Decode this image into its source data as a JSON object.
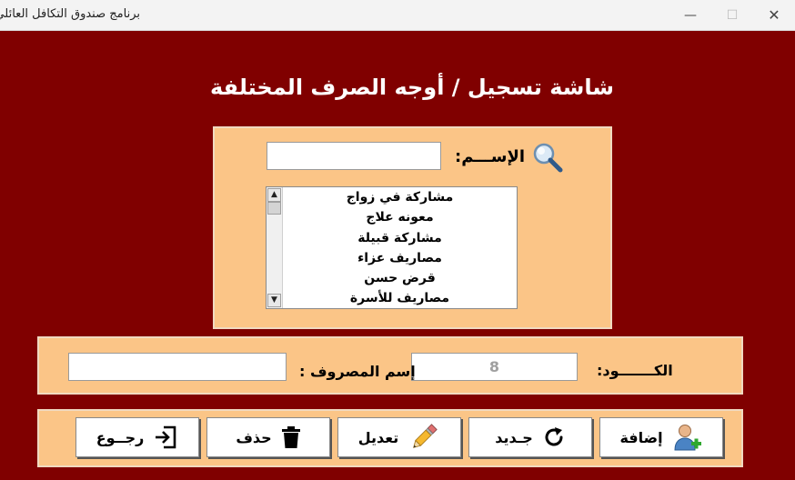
{
  "window": {
    "title": "برنامج صندوق التكافل العائلي",
    "controls": [
      "—",
      "☐",
      "✕"
    ]
  },
  "page": {
    "heading": "شاشة تسجيل / أوجه الصرف المختلفة"
  },
  "search": {
    "label": "الإســـم:",
    "value": "",
    "placeholder": ""
  },
  "list": {
    "items": [
      "مشاركة في زواج",
      "معونه علاج",
      "مشاركة قبيلة",
      "مصاريف عزاء",
      "قرض حسن",
      "مصاريف للأسرة"
    ]
  },
  "form": {
    "code_label": "الكـــــــود:",
    "code_value": "8",
    "name_label": "إسم المصروف :",
    "name_value": ""
  },
  "buttons": {
    "add": "إضافة",
    "new": "جـديد",
    "edit": "تعديل",
    "delete": "حذف",
    "back": "رجــوع"
  },
  "colors": {
    "background": "#800000",
    "panel": "#fbc587",
    "code_text": "#a0a0a0"
  },
  "icons": {
    "search": "magnifier-icon",
    "add": "add-user-icon",
    "new": "refresh-icon",
    "edit": "pencil-icon",
    "delete": "trash-icon",
    "back": "exit-icon"
  }
}
